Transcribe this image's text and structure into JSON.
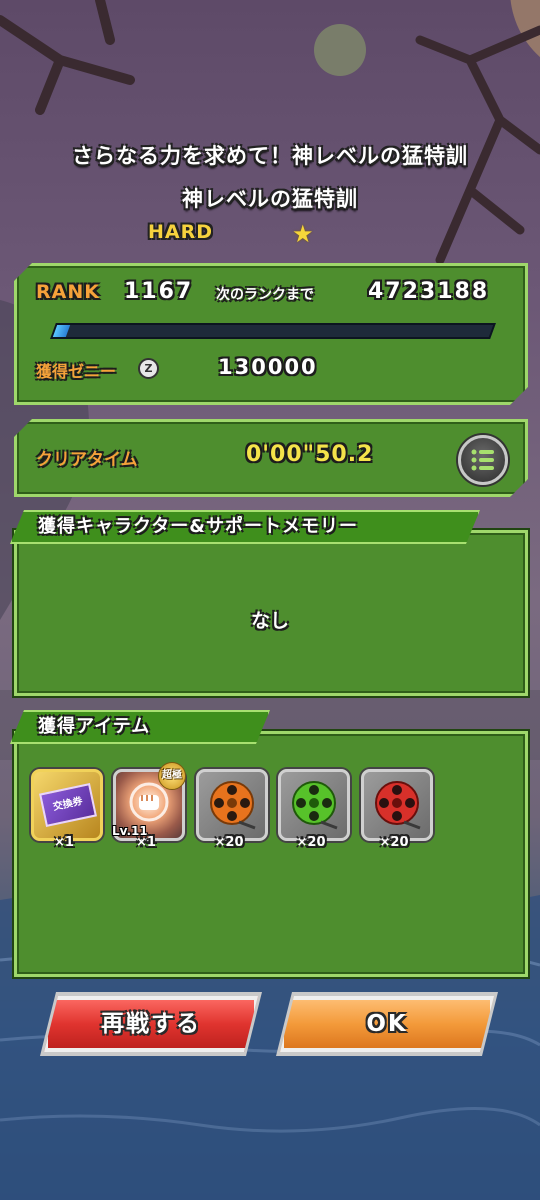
{
  "header": {
    "stage_title": "さらなる力を求めて！神レベルの猛特訓",
    "stage_subtitle": "神レベルの猛特訓",
    "difficulty": "HARD",
    "difficulty_star": "★"
  },
  "rank_panel": {
    "rank_label": "RANK",
    "rank_value": "1167",
    "next_rank_label": "次のランクまで",
    "next_rank_value": "4723188",
    "rank_progress": 0.03,
    "zeni_label": "獲得ゼニー",
    "zeni_icon": "Z",
    "zeni_value": "130000"
  },
  "time_panel": {
    "label": "クリアタイム",
    "value": "0'00\"50.2",
    "list_button_icon": "list-icon"
  },
  "characters_section": {
    "title": "獲得キャラクター&サポートメモリー",
    "empty_text": "なし"
  },
  "items_section": {
    "title": "獲得アイテム",
    "items": [
      {
        "icon": "exchange-ticket-icon",
        "icon_text": "交換券",
        "count": "×1"
      },
      {
        "icon": "training-fist-icon",
        "badge": "超極",
        "level": "Lv.11",
        "count": "×1"
      },
      {
        "icon": "orange-film-reel-icon",
        "count": "×20"
      },
      {
        "icon": "green-film-reel-icon",
        "count": "×20"
      },
      {
        "icon": "red-film-reel-icon",
        "count": "×20"
      }
    ]
  },
  "buttons": {
    "retry": "再戦する",
    "ok": "OK"
  },
  "colors": {
    "panel_green": "#4e8e2e",
    "label_orange": "#f5a23a",
    "value_yellow": "#f4e34a",
    "retry_red": "#e0342f",
    "ok_orange": "#f39a3a"
  }
}
